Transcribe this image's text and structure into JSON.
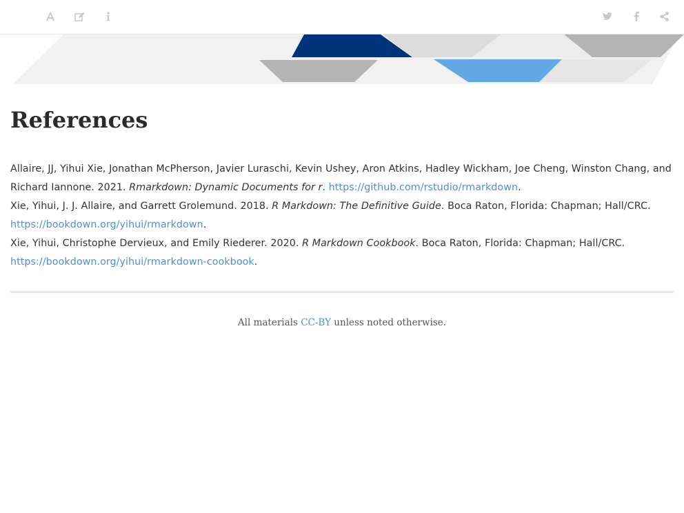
{
  "toolbar": {
    "left_buttons": [
      {
        "icon": "font-icon",
        "title": "Font settings"
      },
      {
        "icon": "edit-icon",
        "title": "Edit"
      },
      {
        "icon": "info-icon",
        "title": "Information"
      }
    ],
    "right_buttons": [
      {
        "icon": "twitter-icon",
        "title": "Twitter"
      },
      {
        "icon": "facebook-icon",
        "title": "Facebook"
      },
      {
        "icon": "share-icon",
        "title": "Share"
      }
    ]
  },
  "banner": {
    "colors": {
      "navy": "#00337a",
      "lightblue": "#62a8e4",
      "gray": "#b4b4b4",
      "lightgray": "#dcdcdc",
      "palegray": "#ececec"
    }
  },
  "page": {
    "title": "References"
  },
  "references": [
    {
      "authors": "Allaire, JJ, Yihui Xie, Jonathan McPherson, Javier Luraschi, Kevin Ushey, Aron Atkins, Hadley Wickham, Joe Cheng, Winston Chang, and Richard Iannone. 2021.",
      "title": "Rmarkdown: Dynamic Documents for r",
      "after_title": ". ",
      "publisher": "",
      "url": "https://github.com/rstudio/rmarkdown",
      "end": "."
    },
    {
      "authors": "Xie, Yihui, J. J. Allaire, and Garrett Grolemund. 2018.",
      "title": "R Markdown: The Definitive Guide",
      "after_title": ". ",
      "publisher": "Boca Raton, Florida: Chapman; Hall/CRC. ",
      "url": "https://bookdown.org/yihui/rmarkdown",
      "end": "."
    },
    {
      "authors": "Xie, Yihui, Christophe Dervieux, and Emily Riederer. 2020.",
      "title": "R Markdown Cookbook",
      "after_title": ". ",
      "publisher": "Boca Raton, Florida: Chapman; Hall/CRC. ",
      "url": "https://bookdown.org/yihui/rmarkdown-cookbook",
      "end": "."
    }
  ],
  "footer": {
    "prefix": "All materials ",
    "license_link": "CC-BY",
    "suffix": " unless noted otherwise."
  }
}
